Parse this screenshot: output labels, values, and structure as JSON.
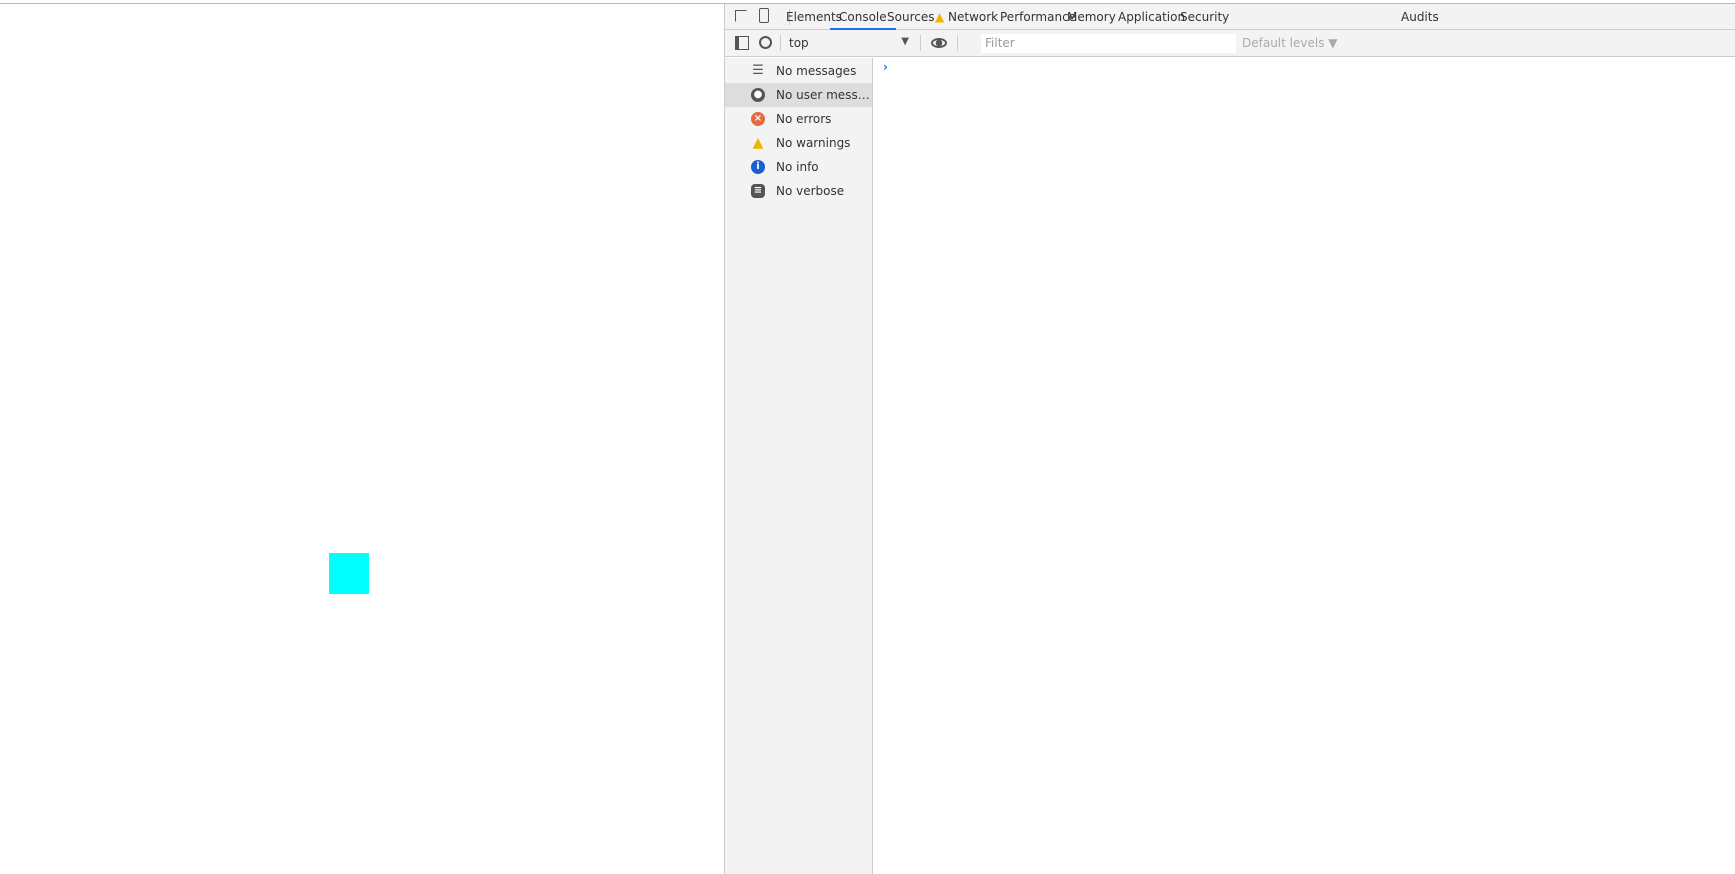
{
  "devtools": {
    "tabs": [
      {
        "label": "Elements"
      },
      {
        "label": "Console",
        "active": true
      },
      {
        "label": "Sources"
      },
      {
        "label": "Network",
        "warning": true
      },
      {
        "label": "Performance"
      },
      {
        "label": "Memory"
      },
      {
        "label": "Application"
      },
      {
        "label": "Security"
      },
      {
        "label": "Audits"
      }
    ],
    "toolbar": {
      "context": "top",
      "filter_placeholder": "Filter",
      "levels": "Default levels ▼"
    },
    "sidebar": [
      {
        "label": "No messages",
        "icon": "list-icon"
      },
      {
        "label": "No user messages",
        "icon": "user-icon"
      },
      {
        "label": "No errors",
        "icon": "error-icon",
        "color": "#e46a3f"
      },
      {
        "label": "No warnings",
        "icon": "warning-icon",
        "color": "#f0b400"
      },
      {
        "label": "No info",
        "icon": "info-icon",
        "color": "#1a5fd1"
      },
      {
        "label": "No verbose",
        "icon": "bug-icon",
        "color": "#555555"
      }
    ],
    "prompt": "›"
  },
  "page": {
    "square_color": "#00ffff"
  }
}
